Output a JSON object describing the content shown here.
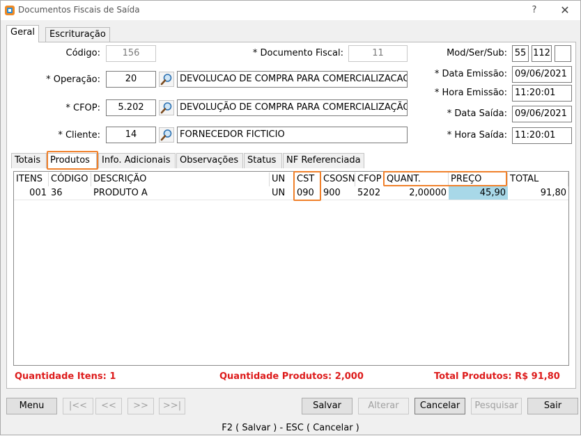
{
  "window": {
    "title": "Documentos Fiscais de Saída",
    "help": "?",
    "close": "✕"
  },
  "main_tabs": [
    "Geral",
    "Escrituração"
  ],
  "form": {
    "codigo_label": "Código:",
    "codigo_value": "156",
    "doc_fiscal_label": "* Documento Fiscal:",
    "doc_fiscal_value": "11",
    "mod_label": "Mod/Ser/Sub:",
    "mod_value": "55",
    "ser_value": "112",
    "sub_value": "",
    "operacao_label": "* Operação:",
    "operacao_code": "20",
    "operacao_desc": "DEVOLUCAO DE COMPRA PARA COMERCIALIZACAO",
    "data_emissao_label": "* Data Emissão:",
    "data_emissao_value": "09/06/2021",
    "hora_emissao_label": "* Hora Emissão:",
    "hora_emissao_value": "11:20:01",
    "cfop_label": "* CFOP:",
    "cfop_code": "5.202",
    "cfop_desc": "DEVOLUÇÃO DE COMPRA PARA COMERCIALIZAÇÃO",
    "data_saida_label": "* Data Saída:",
    "data_saida_value": "09/06/2021",
    "cliente_label": "* Cliente:",
    "cliente_code": "14",
    "cliente_desc": "FORNECEDOR FICTICIO",
    "hora_saida_label": "* Hora Saída:",
    "hora_saida_value": "11:20:01"
  },
  "inner_tabs": [
    "Totais",
    "Produtos",
    "Info. Adicionais",
    "Observações",
    "Status",
    "NF Referenciada"
  ],
  "grid": {
    "headers": [
      "ITENS",
      "CÓDIGO",
      "DESCRIÇÃO",
      "UN",
      "CST",
      "CSOSN",
      "CFOP",
      "QUANT.",
      "PREÇO",
      "TOTAL"
    ],
    "rows": [
      [
        "001",
        "36",
        "PRODUTO A",
        "UN",
        "090",
        "900",
        "5202",
        "2,00000",
        "45,90",
        "91,80"
      ]
    ]
  },
  "summary": {
    "qtd_itens": "Quantidade Itens: 1",
    "qtd_produtos": "Quantidade Produtos: 2,000",
    "total_produtos": "Total Produtos: R$ 91,80"
  },
  "buttons": {
    "menu": "Menu",
    "first": "|<<",
    "prev": "<<",
    "next": ">>",
    "last": ">>|",
    "salvar": "Salvar",
    "alterar": "Alterar",
    "cancelar": "Cancelar",
    "pesquisar": "Pesquisar",
    "sair": "Sair"
  },
  "status_bar": "F2 ( Salvar )   -   ESC ( Cancelar )",
  "colors": {
    "highlight": "#f0802a",
    "summary_text": "#dd1b1b",
    "selected_cell": "#a8d8e8"
  }
}
